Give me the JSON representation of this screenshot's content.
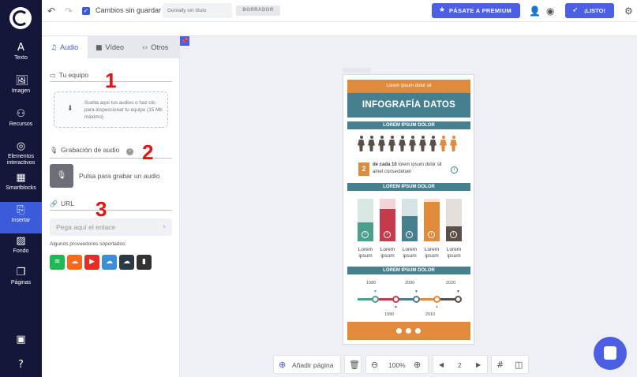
{
  "nav": {
    "items": [
      {
        "label": "Texto",
        "icon": "text-icon",
        "glyph": "A"
      },
      {
        "label": "Imagen",
        "icon": "image-icon",
        "glyph": "🖼"
      },
      {
        "label": "Recursos",
        "icon": "resources-icon",
        "glyph": "⚇"
      },
      {
        "label": "Elementos interactivos",
        "icon": "interactive-icon",
        "glyph": "◎"
      },
      {
        "label": "Smartblocks",
        "icon": "smartblocks-icon",
        "glyph": "▦"
      },
      {
        "label": "Insertar",
        "icon": "insert-icon",
        "glyph": "⎘"
      },
      {
        "label": "Fondo",
        "icon": "background-icon",
        "glyph": "▨"
      },
      {
        "label": "Páginas",
        "icon": "pages-icon",
        "glyph": "❐"
      }
    ]
  },
  "topbar": {
    "save_status": "Cambios sin guardar",
    "title_placeholder": "Genially sin título",
    "draft_badge": "BORRADOR",
    "premium_label": "PÁSATE A PREMIUM",
    "done_label": "¡LISTO!"
  },
  "panel": {
    "tabs": [
      {
        "label": "Audio",
        "icon": "music-icon",
        "glyph": "♫"
      },
      {
        "label": "Vídeo",
        "icon": "video-icon",
        "glyph": "■"
      },
      {
        "label": "Otros",
        "icon": "code-icon",
        "glyph": "‹›"
      }
    ],
    "section_device": "Tu equipo",
    "drop_text": "Suelta aquí tus audios o haz clic para inspeccionar tu equipo (15 Mb máximo)",
    "section_record": "Grabación de audio",
    "record_text": "Pulsa para grabar un audio",
    "section_url": "URL",
    "url_placeholder": "Pega aquí el enlace",
    "providers_label": "Algunos proveedores soportados:",
    "providers": [
      {
        "name": "spotify",
        "color": "#1db954",
        "glyph": "≋"
      },
      {
        "name": "soundcloud",
        "color": "#ff6a1a",
        "glyph": "☁"
      },
      {
        "name": "youtube",
        "color": "#e52d27",
        "glyph": "▶"
      },
      {
        "name": "mixcloud",
        "color": "#3b8fd8",
        "glyph": "☁"
      },
      {
        "name": "audiomack",
        "color": "#2b3845",
        "glyph": "☁"
      },
      {
        "name": "audioboom",
        "color": "#333333",
        "glyph": "▮"
      }
    ]
  },
  "steps": [
    "1",
    "2",
    "3"
  ],
  "infographic": {
    "header": "Lorem ipsum dolor sit",
    "title": "INFOGRAFÍA DATOS",
    "band_1": "LOREM IPSUM DOLOR",
    "band_2": "LOREM IPSUM DOLOR",
    "band_3": "LOREM IPSUM DOLOR",
    "stat_number": "2",
    "stat_text_bold": "de cada 10",
    "stat_text": "lorem ipsum dolor sit amet consectetuer",
    "people_total": 10,
    "people_highlight": 2,
    "bars": [
      {
        "label": "Lorem ipsum",
        "fill": 0.44,
        "color": "#4aa08a",
        "bg": "#d8e9e4"
      },
      {
        "label": "Lorem ipsum",
        "fill": 0.76,
        "color": "#c63a4e",
        "bg": "#f4d3d8"
      },
      {
        "label": "Lorem ipsum",
        "fill": 0.6,
        "color": "#46808f",
        "bg": "#d6e3e7"
      },
      {
        "label": "Lorem ipsum",
        "fill": 0.92,
        "color": "#e08a3c",
        "bg": "#f6e1cc"
      },
      {
        "label": "Lorem ipsum",
        "fill": 0.36,
        "color": "#5b5048",
        "bg": "#e2dfdc"
      }
    ],
    "years_top": [
      "1980",
      "2000",
      "2020"
    ],
    "years_bottom": [
      "1990",
      "2010"
    ]
  },
  "bottombar": {
    "add_page": "Añadir página",
    "zoom": "100%",
    "page_number": "2"
  },
  "colors": {
    "accent": "#4b5ee4",
    "nav_bg": "#14163a",
    "teal": "#46808f",
    "orange": "#e08a3c"
  }
}
